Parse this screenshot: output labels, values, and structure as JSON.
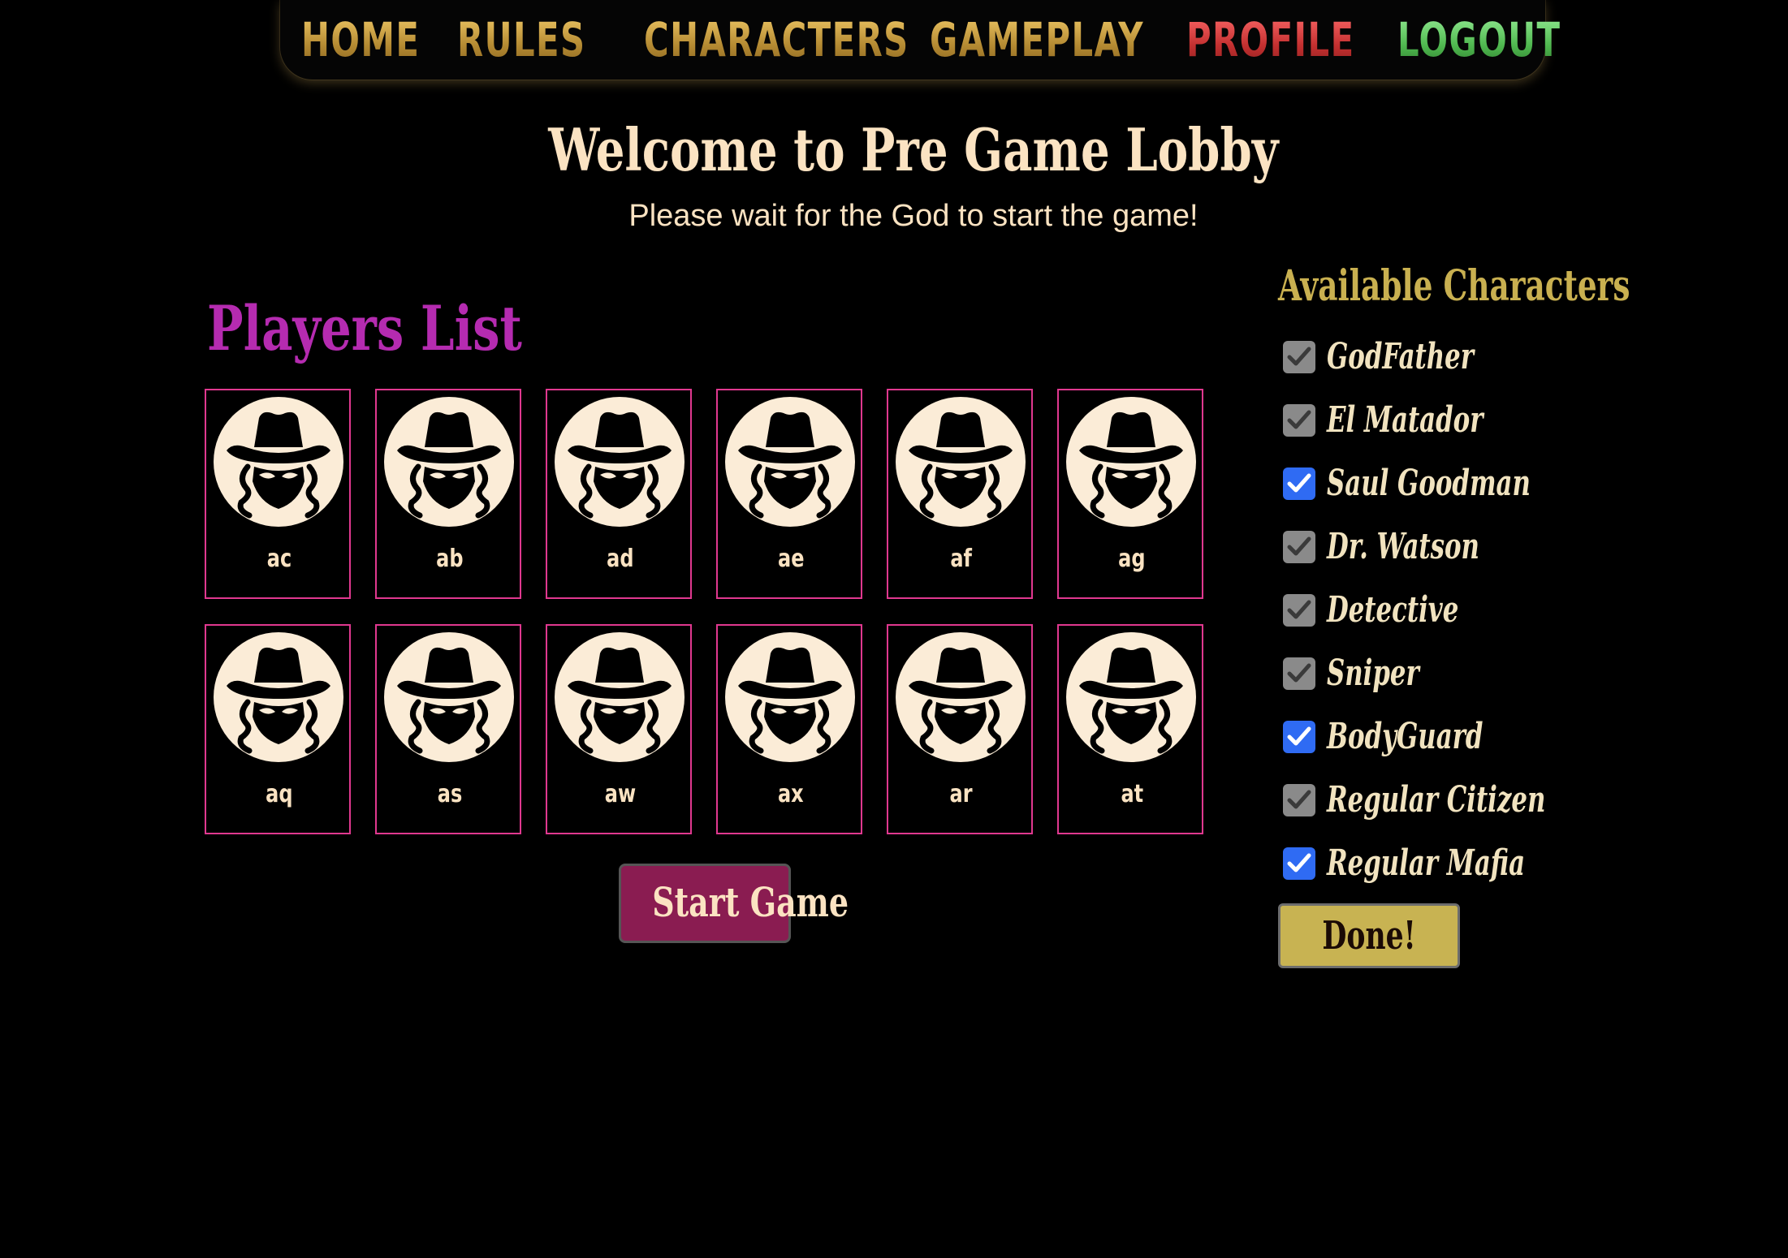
{
  "nav": {
    "items": [
      {
        "label": "HOME",
        "style": "gold"
      },
      {
        "label": "RULES",
        "style": "gold"
      },
      {
        "label": "CHARACTERS",
        "style": "gold"
      },
      {
        "label": "GAMEPLAY",
        "style": "gold"
      },
      {
        "label": "PROFILE",
        "style": "red"
      },
      {
        "label": "LOGOUT",
        "style": "green"
      }
    ]
  },
  "header": {
    "title": "Welcome to Pre Game Lobby",
    "subtitle": "Please wait for the God to start the game!"
  },
  "players": {
    "title": "Players List",
    "avatar_icon": "spy-avatar-icon",
    "list": [
      "ac",
      "ab",
      "ad",
      "ae",
      "af",
      "ag",
      "aq",
      "as",
      "aw",
      "ax",
      "ar",
      "at"
    ]
  },
  "start_button": "Start Game",
  "characters": {
    "title": "Available Characters",
    "items": [
      {
        "label": "GodFather",
        "checked": true,
        "disabled": true
      },
      {
        "label": "El Matador",
        "checked": true,
        "disabled": true
      },
      {
        "label": "Saul Goodman",
        "checked": true,
        "disabled": false
      },
      {
        "label": "Dr. Watson",
        "checked": true,
        "disabled": true
      },
      {
        "label": "Detective",
        "checked": true,
        "disabled": true
      },
      {
        "label": "Sniper",
        "checked": true,
        "disabled": true
      },
      {
        "label": "BodyGuard",
        "checked": true,
        "disabled": false
      },
      {
        "label": "Regular Citizen",
        "checked": true,
        "disabled": true
      },
      {
        "label": "Regular Mafia",
        "checked": true,
        "disabled": false
      }
    ],
    "done_label": "Done!"
  },
  "colors": {
    "background": "#000000",
    "accent_pink": "#e0388f",
    "players_title": "#b52bb0",
    "start_button": "#8a1c51",
    "done_button": "#c8b352",
    "checkbox_active": "#2f6bf3",
    "checkbox_disabled": "#8a8a8a",
    "cream_text": "#fbe3c2"
  }
}
